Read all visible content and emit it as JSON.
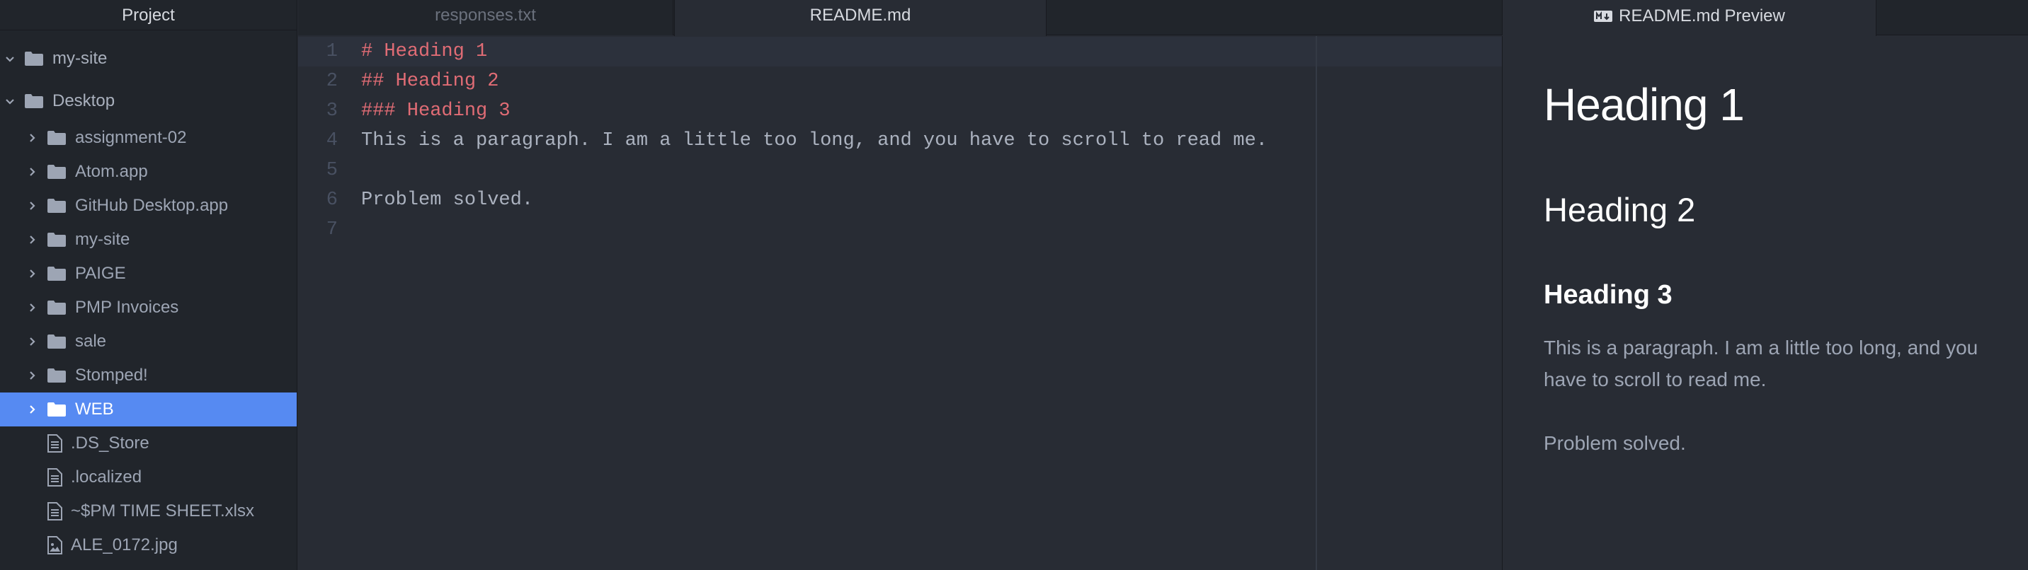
{
  "tree": {
    "header": "Project",
    "items": [
      {
        "label": "my-site",
        "kind": "root-folder",
        "expanded": true,
        "icon": "folder-icon"
      },
      {
        "label": "Desktop",
        "kind": "root-folder",
        "expanded": true,
        "icon": "folder-icon"
      },
      {
        "label": "assignment-02",
        "kind": "folder",
        "icon": "folder-icon"
      },
      {
        "label": "Atom.app",
        "kind": "folder",
        "icon": "folder-icon"
      },
      {
        "label": "GitHub Desktop.app",
        "kind": "folder",
        "icon": "folder-icon"
      },
      {
        "label": "my-site",
        "kind": "folder",
        "icon": "folder-icon"
      },
      {
        "label": "PAIGE",
        "kind": "folder",
        "icon": "folder-icon"
      },
      {
        "label": "PMP Invoices",
        "kind": "folder",
        "icon": "folder-icon"
      },
      {
        "label": "sale",
        "kind": "folder",
        "icon": "folder-icon"
      },
      {
        "label": "Stomped!",
        "kind": "folder",
        "icon": "folder-icon"
      },
      {
        "label": "WEB",
        "kind": "folder",
        "icon": "folder-icon",
        "selected": true
      },
      {
        "label": ".DS_Store",
        "kind": "file",
        "icon": "file-text-icon"
      },
      {
        "label": ".localized",
        "kind": "file",
        "icon": "file-text-icon"
      },
      {
        "label": "~$PM TIME SHEET.xlsx",
        "kind": "file",
        "icon": "file-text-icon"
      },
      {
        "label": "ALE_0172.jpg",
        "kind": "file",
        "icon": "file-image-icon"
      }
    ]
  },
  "tabs": {
    "left": [
      {
        "label": "responses.txt",
        "active": false
      },
      {
        "label": "README.md",
        "active": true
      }
    ],
    "preview": {
      "label": "README.md Preview",
      "icon": "markdown-icon"
    }
  },
  "editor": {
    "lines": [
      {
        "number": "1",
        "text": "# Heading 1",
        "style": "heading"
      },
      {
        "number": "2",
        "text": "## Heading 2",
        "style": "heading"
      },
      {
        "number": "3",
        "text": "### Heading 3",
        "style": "heading"
      },
      {
        "number": "4",
        "text": "This is a paragraph. I am a little too long, and you have to scroll to read me.",
        "style": "text"
      },
      {
        "number": "5",
        "text": "",
        "style": "text"
      },
      {
        "number": "6",
        "text": "Problem solved.",
        "style": "text"
      },
      {
        "number": "7",
        "text": "",
        "style": "text"
      }
    ]
  },
  "preview": {
    "h1": "Heading 1",
    "h2": "Heading 2",
    "h3": "Heading 3",
    "paragraph": "This is a paragraph. I am a little too long, and you have to scroll to read me.",
    "paragraph2": "Problem solved."
  },
  "colors": {
    "background": "#282c34",
    "panel": "#21252b",
    "selection": "#568af2",
    "heading_syntax": "#e06c75",
    "text": "#abb2bf"
  }
}
